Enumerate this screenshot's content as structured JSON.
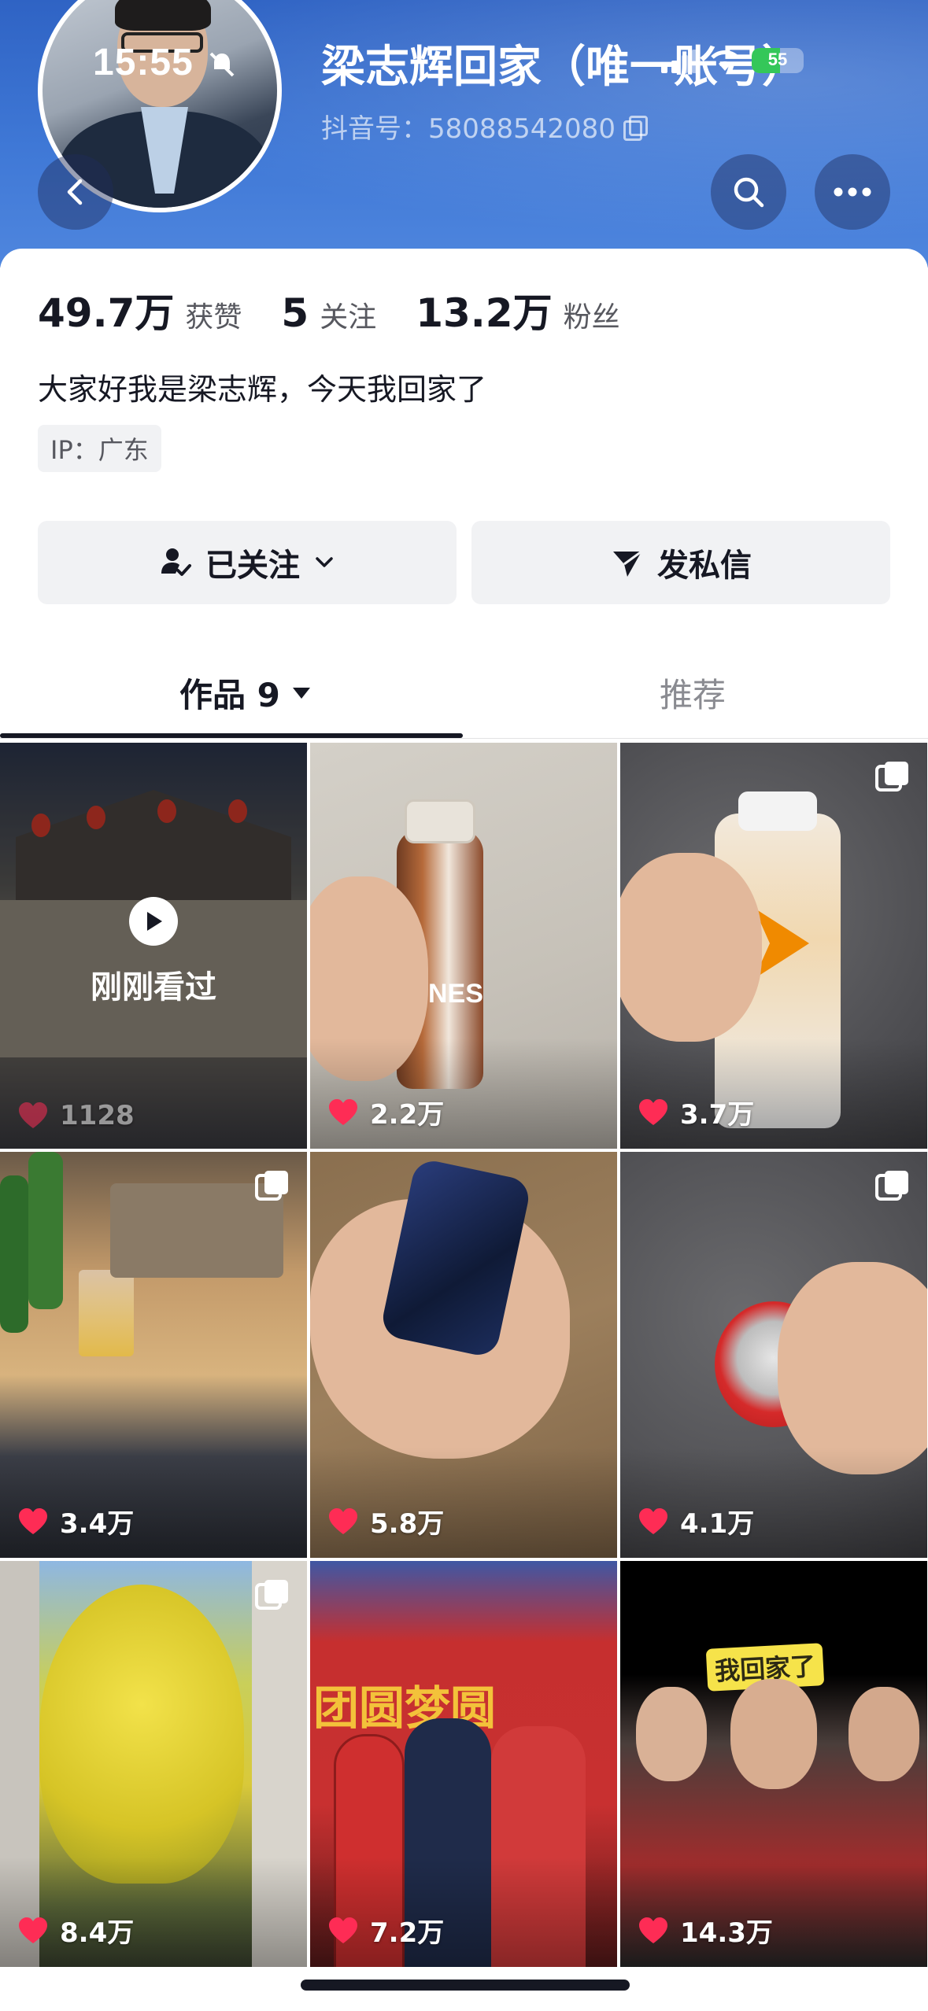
{
  "status_bar": {
    "time": "15:55",
    "battery": "55",
    "battery_level": 0.55
  },
  "profile": {
    "name": "梁志辉回家（唯一账号）",
    "douyin_id": "抖音号：58088542080",
    "bio": "大家好我是梁志辉，今天我回家了",
    "ip": "IP：广东"
  },
  "stats": [
    {
      "value": "49.7万",
      "label": "获赞"
    },
    {
      "value": "5",
      "label": "关注"
    },
    {
      "value": "13.2万",
      "label": "粉丝"
    }
  ],
  "actions": {
    "follow": "已关注",
    "message": "发私信"
  },
  "tabs": {
    "works": "作品 9",
    "recommend": "推荐"
  },
  "videos": [
    {
      "likes": "1128",
      "overlay": "刚刚看过"
    },
    {
      "likes": "2.2万",
      "brand": "NES"
    },
    {
      "likes": "3.7万"
    },
    {
      "likes": "3.4万"
    },
    {
      "likes": "5.8万"
    },
    {
      "likes": "4.1万"
    },
    {
      "likes": "8.4万"
    },
    {
      "likes": "7.2万",
      "banner": "团圆梦圆"
    },
    {
      "likes": "14.3万",
      "sticker": "我回家了"
    }
  ],
  "colors": {
    "header": "#3a70d0",
    "heart": "#fe2c55",
    "battery": "#34c759"
  }
}
